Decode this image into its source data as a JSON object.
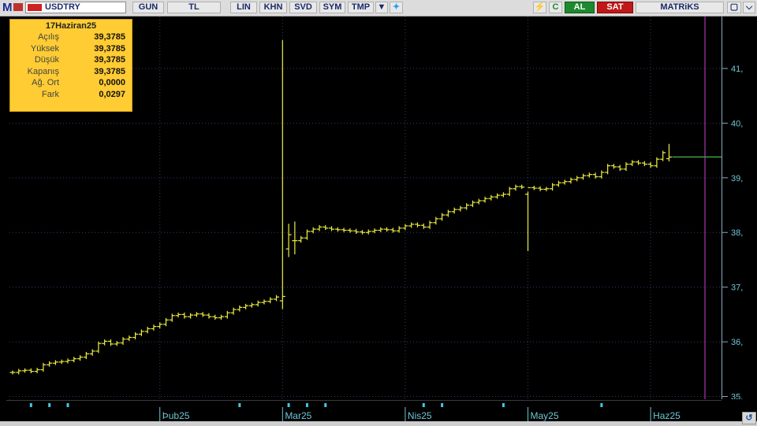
{
  "toolbar": {
    "logo": "M",
    "symbol": "USDTRY",
    "buttons": [
      "GUN",
      "TL",
      "LIN",
      "KHN",
      "SVD",
      "SYM",
      "TMP"
    ],
    "dropdown_icon": "chevron-down-icon",
    "twitter_icon": "twitter-icon",
    "flash_icon": "lightning-icon",
    "refresh_label": "C",
    "buy_label": "AL",
    "sell_label": "SAT",
    "brand": "MATRiKS",
    "window_icon": "window-icon",
    "buy_color": "#1e8a2e",
    "sell_color": "#c01818"
  },
  "info_panel": {
    "date": "17Haziran25",
    "rows": [
      {
        "label": "Açılış",
        "value": "39,3785"
      },
      {
        "label": "Yüksek",
        "value": "39,3785"
      },
      {
        "label": "Düşük",
        "value": "39,3785"
      },
      {
        "label": "Kapanış",
        "value": "39,3785"
      },
      {
        "label": "Ağ. Ort",
        "value": "0,0000"
      },
      {
        "label": "Fark",
        "value": "0,0297"
      }
    ],
    "background": "#ffcc33"
  },
  "chart_data": {
    "type": "ohlc",
    "series_color": "#f0f040",
    "ylim": [
      34.95,
      41.95
    ],
    "y_ticks": [
      35,
      36,
      37,
      38,
      39,
      40,
      41
    ],
    "y_tick_labels": [
      "35,",
      "36,",
      "37,",
      "38,",
      "39,",
      "40,",
      "41,"
    ],
    "x_labels": [
      {
        "label": "Þub25",
        "index": 24
      },
      {
        "label": "Mar25",
        "index": 44
      },
      {
        "label": "Nis25",
        "index": 64
      },
      {
        "label": "May25",
        "index": 84
      },
      {
        "label": "Haz25",
        "index": 104
      }
    ],
    "event_marker_indices": [
      3,
      6,
      9,
      37,
      45,
      48,
      51,
      67,
      70,
      80,
      96
    ],
    "close": [
      35.44,
      35.47,
      35.48,
      35.46,
      35.49,
      35.58,
      35.61,
      35.63,
      35.64,
      35.66,
      35.69,
      35.72,
      35.78,
      35.83,
      35.97,
      36.01,
      35.96,
      35.98,
      36.05,
      36.08,
      36.14,
      36.19,
      36.24,
      36.28,
      36.32,
      36.4,
      36.48,
      36.5,
      36.46,
      36.49,
      36.51,
      36.49,
      36.46,
      36.44,
      36.46,
      36.53,
      36.59,
      36.63,
      36.66,
      36.68,
      36.72,
      36.74,
      36.78,
      36.82,
      36.83,
      37.96,
      37.85,
      37.9,
      38.02,
      38.06,
      38.1,
      38.08,
      38.06,
      38.05,
      38.04,
      38.03,
      38.01,
      38,
      38.02,
      38.04,
      38.06,
      38.05,
      38.03,
      38.08,
      38.12,
      38.15,
      38.13,
      38.1,
      38.18,
      38.25,
      38.32,
      38.38,
      38.42,
      38.45,
      38.5,
      38.55,
      38.58,
      38.62,
      38.65,
      38.68,
      38.7,
      38.8,
      38.84,
      38.83,
      38.82,
      38.81,
      38.79,
      38.8,
      38.87,
      38.91,
      38.93,
      38.97,
      39,
      39.04,
      39.06,
      39.02,
      39.1,
      39.22,
      39.2,
      39.16,
      39.25,
      39.29,
      39.27,
      39.25,
      39.22,
      39.34,
      39.46,
      39.38
    ],
    "special_bars": [
      {
        "index": 44,
        "open": 36.75,
        "high": 41.52,
        "low": 36.6,
        "close": 36.83
      },
      {
        "index": 45,
        "open": 37.7,
        "high": 38.16,
        "low": 37.55,
        "close": 37.96
      },
      {
        "index": 46,
        "open": 37.85,
        "high": 38.2,
        "low": 37.6,
        "close": 37.85
      },
      {
        "index": 84,
        "open": 38.7,
        "high": 38.75,
        "low": 37.66,
        "close": 38.82
      },
      {
        "index": 107,
        "open": 39.35,
        "high": 39.62,
        "low": 39.3,
        "close": 39.38
      }
    ]
  }
}
